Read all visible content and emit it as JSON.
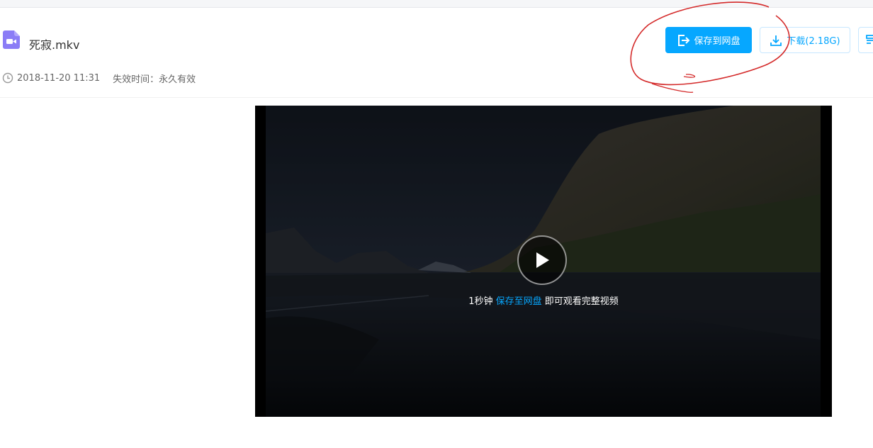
{
  "file": {
    "name": "死寂.mkv",
    "icon": "video-file-icon",
    "icon_color": "#8b7cf6"
  },
  "meta": {
    "date": "2018-11-20 11:31",
    "expire_label": "失效时间：永久有效"
  },
  "actions": {
    "save_label": "保存到网盘",
    "download_label": "下载(2.18G)"
  },
  "player": {
    "msg_prefix": "1秒钟",
    "msg_link": "保存至网盘",
    "msg_suffix": "即可观看完整视频"
  },
  "colors": {
    "accent": "#06a7ff",
    "annotation": "#d42a2a"
  }
}
